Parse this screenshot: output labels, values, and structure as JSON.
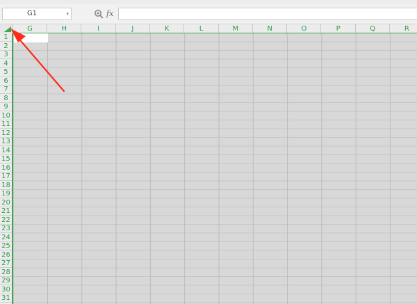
{
  "formula_bar": {
    "name_box_value": "G1",
    "fx_label": "fx",
    "formula_value": ""
  },
  "grid": {
    "columns": [
      "G",
      "H",
      "I",
      "J",
      "K",
      "L",
      "M",
      "N",
      "O",
      "P",
      "Q",
      "R"
    ],
    "rows": [
      "1",
      "2",
      "3",
      "4",
      "5",
      "6",
      "7",
      "8",
      "9",
      "10",
      "11",
      "12",
      "13",
      "14",
      "15",
      "16",
      "17",
      "18",
      "19",
      "20",
      "21",
      "22",
      "23",
      "24",
      "25",
      "26",
      "27",
      "28",
      "29",
      "30",
      "31"
    ],
    "active_cell": "G1"
  },
  "colors": {
    "header_accent": "#3aa852",
    "header_text": "#2e9e45",
    "annotation_arrow": "#ff2a1a"
  },
  "icons": {
    "zoom": "magnifier-zoom-icon",
    "select_all": "select-all-triangle-icon",
    "dropdown": "chevron-down-icon"
  }
}
